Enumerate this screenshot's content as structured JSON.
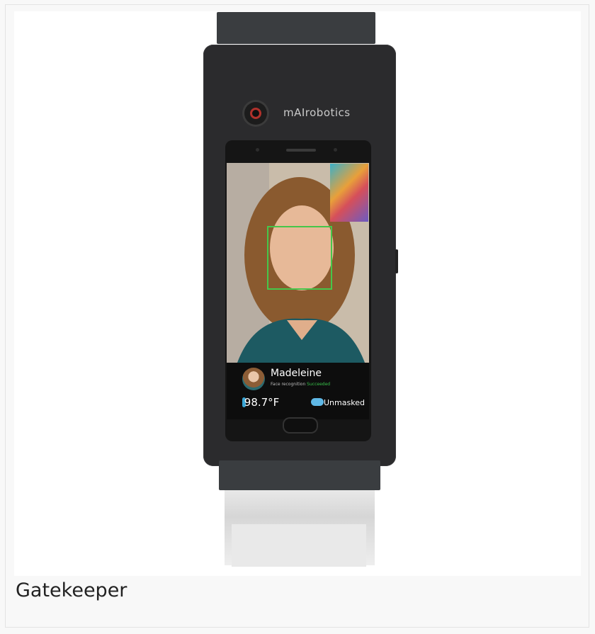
{
  "device": {
    "brand": "mAIrobotics",
    "screen": {
      "person_name": "Madeleine",
      "recognition_label": "Face recognition",
      "recognition_status": "Succeeded",
      "temperature": "98.7°F",
      "mask_status": "Unmasked"
    }
  },
  "caption": "Gatekeeper",
  "colors": {
    "recognition_box": "#46c64a",
    "status_ok": "#38c14a",
    "device_body": "#2b2b2d"
  }
}
